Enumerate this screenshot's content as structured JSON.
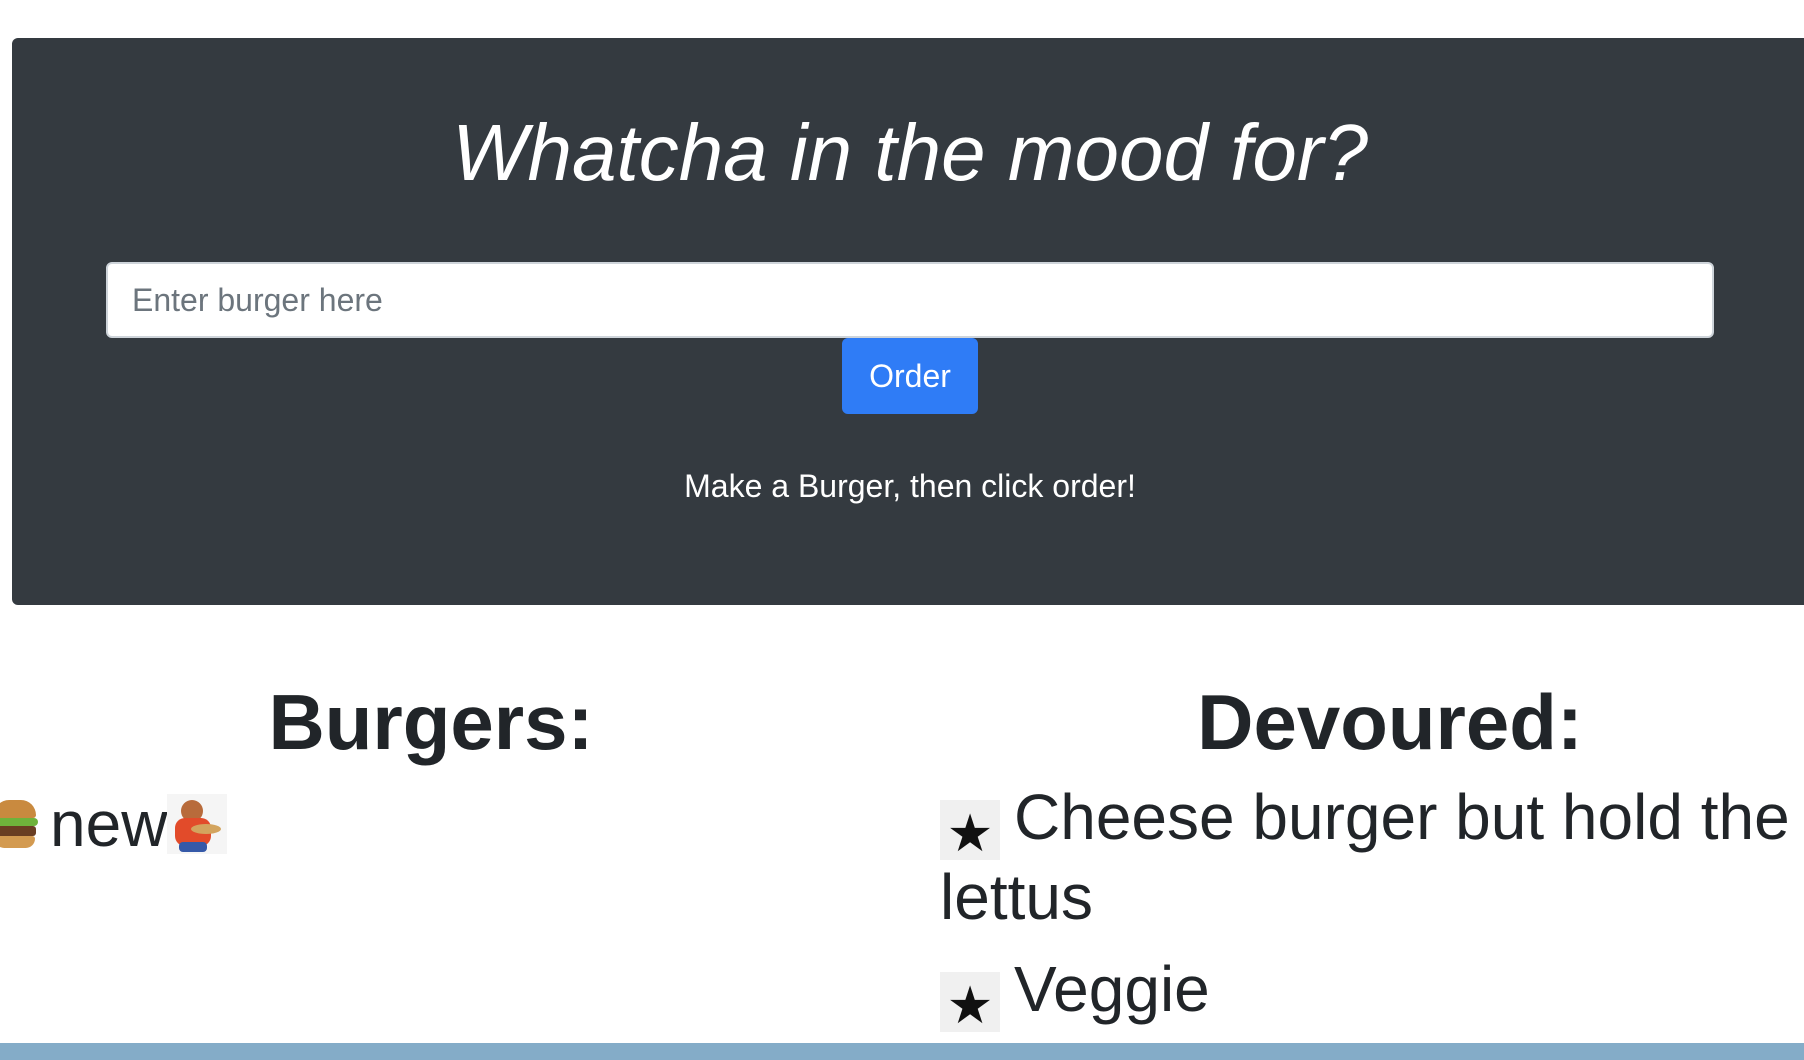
{
  "header": {
    "title": "Whatcha in the mood for?",
    "input_placeholder": "Enter burger here",
    "order_button_label": "Order",
    "instructions": "Make a Burger, then click order!"
  },
  "burgers": {
    "heading": "Burgers:",
    "items": [
      {
        "name": "new",
        "leading_icon": "burger-icon",
        "trailing_icon": "devour-icon"
      }
    ]
  },
  "devoured": {
    "heading": "Devoured:",
    "icon": "star-icon",
    "items": [
      {
        "name": "Cheese burger but hold the lettus"
      },
      {
        "name": "Veggie"
      }
    ]
  },
  "colors": {
    "header_background": "#343a40",
    "button_primary": "#2f7cf6",
    "text_dark": "#212529",
    "bottom_bar": "#84acc8"
  }
}
